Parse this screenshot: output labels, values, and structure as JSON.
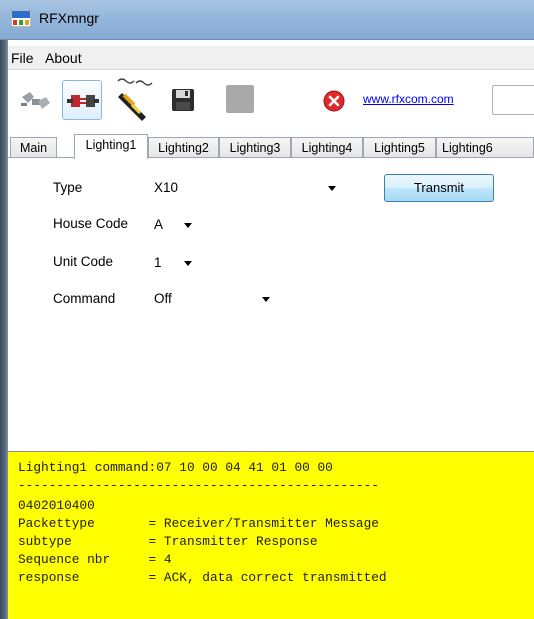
{
  "window": {
    "title": "RFXmngr",
    "icon": "rfx-app-icon"
  },
  "menu": {
    "items": [
      "File",
      "About"
    ]
  },
  "toolbar": {
    "buttons": [
      "connect-icon",
      "disconnect-icon",
      "record-icon",
      "save-icon",
      "stop-icon",
      "close-icon"
    ],
    "link": "www.rfxcom.com"
  },
  "tabs": [
    "Main",
    "Lighting1",
    "Lighting2",
    "Lighting3",
    "Lighting4",
    "Lighting5",
    "Lighting6"
  ],
  "active_tab": "Lighting1",
  "form": {
    "type_label": "Type",
    "type_value": "X10",
    "house_code_label": "House Code",
    "house_code_value": "A",
    "unit_code_label": "Unit Code",
    "unit_code_value": "1",
    "command_label": "Command",
    "command_value": "Off",
    "transmit_label": "Transmit"
  },
  "output": {
    "lines": [
      "Lighting1 command:07 10 00 04 41 01 00 00",
      "-----------------------------------------------",
      "0402010400",
      "Packettype       = Receiver/Transmitter Message",
      "subtype          = Transmitter Response",
      "Sequence nbr     = 4",
      "response         = ACK, data correct transmitted"
    ],
    "background": "#ffff00"
  }
}
